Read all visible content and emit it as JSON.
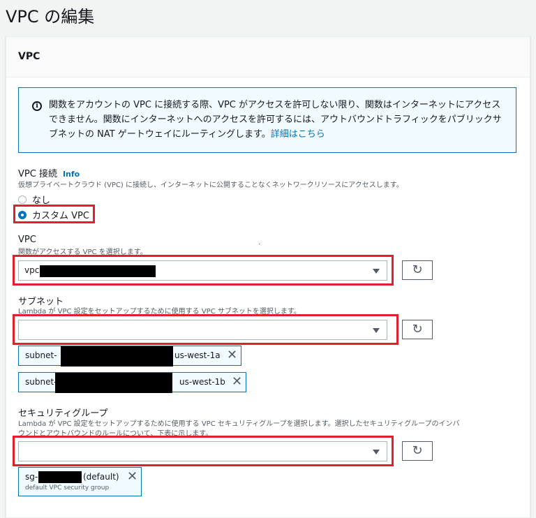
{
  "page": {
    "title": "VPC の編集"
  },
  "panel": {
    "title": "VPC"
  },
  "alert": {
    "text": "関数をアカウントの VPC に接続する際、VPC がアクセスを許可しない限り、関数はインターネットにアクセスできません。関数にインターネットへのアクセスを許可するには、アウトバウンドトラフィックをパブリックサブネットの NAT ゲートウェイにルーティングします。",
    "link": "詳細はこちら",
    "icon": "info-icon"
  },
  "vpc_connection": {
    "label": "VPC 接続",
    "info": "Info",
    "description": "仮想プライベートクラウド (VPC) に接続し、インターネットに公開することなくネットワークリソースにアクセスします。",
    "options": [
      {
        "label": "なし",
        "selected": false
      },
      {
        "label": "カスタム VPC",
        "selected": true
      }
    ]
  },
  "vpc": {
    "label": "VPC",
    "description": "関数がアクセスする VPC を選択します。",
    "value": "vpc-"
  },
  "subnet": {
    "label": "サブネット",
    "description": "Lambda が VPC 設定をセットアップするために使用する VPC サブネットを選択します。",
    "value": "",
    "tokens": [
      {
        "prefix": "subnet-",
        "az": "us-west-1a"
      },
      {
        "prefix": "subnet-",
        "az": "us-west-1b"
      }
    ]
  },
  "security_group": {
    "label": "セキュリティグループ",
    "description_line1": "Lambda が VPC 設定をセットアップするために使用する VPC セキュリティグループを選択します。選択したセキュリティグループのインバ",
    "description_line2": "ウンドとアウトバウンドのルールについて、下表に示します。",
    "value": "",
    "tokens": [
      {
        "prefix": "sg-",
        "suffix": "(default)",
        "description": "default VPC security group"
      }
    ]
  },
  "colors": {
    "accent": "#0073bb",
    "highlight": "#e0202e",
    "alert_bg": "#f1faff"
  }
}
